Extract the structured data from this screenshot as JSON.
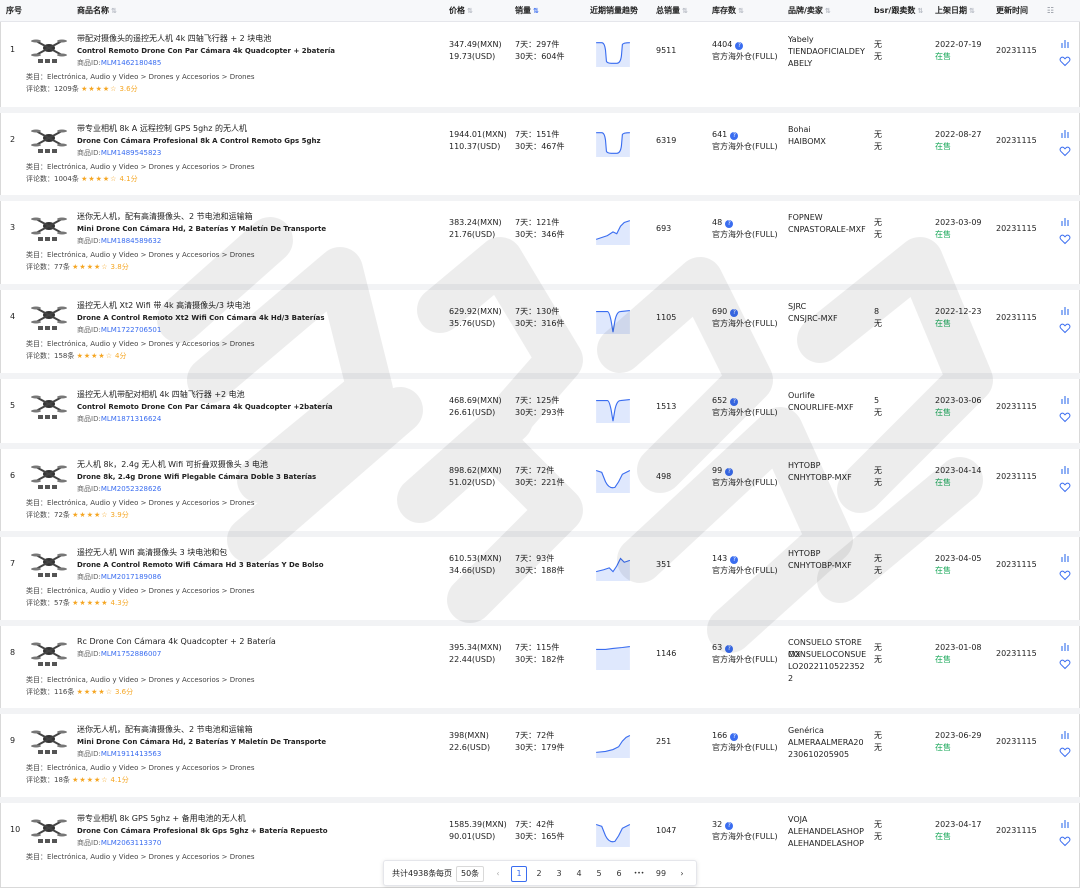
{
  "columns": {
    "idx": "序号",
    "name": "商品名称",
    "price": "价格",
    "sales": "销量",
    "trend": "近期销量趋势",
    "total": "总销量",
    "stock": "库存数",
    "brand": "品牌/卖家",
    "bsr": "bsr/跟卖数",
    "date": "上架日期",
    "updated": "更新时间"
  },
  "labels": {
    "cat_prefix": "类目：",
    "rev_prefix": "评论数：",
    "rev_unit": "条",
    "pid_prefix": "商品ID:",
    "score_unit": "分",
    "in_stock": "在售",
    "warehouse": "官方海外仓(FULL)",
    "d7": "7天：",
    "d30": "30天：",
    "unit": "件",
    "q": "?"
  },
  "colors": {
    "accent": "#3a6df0",
    "instock": "#1aa85a",
    "star": "#f5a623",
    "spark": "#3a6df0"
  },
  "rows": [
    {
      "idx": "1",
      "cn": "带配对摄像头的遥控无人机 4k 四轴飞行器 + 2 块电池",
      "es": "Control Remoto Drone Con Par Cámara 4k Quadcopter + 2batería",
      "pid": "MLM1462180485",
      "cat": "Electrónica, Audio y Video > Drones y Accesorios > Drones",
      "reviews": "1209",
      "stars": 3.5,
      "score": "3.6",
      "p_mxn": "347.49(MXN)",
      "p_usd": "19.73(USD)",
      "s7": "297",
      "s30": "604",
      "trend": "dip",
      "total": "9511",
      "stock": "4404",
      "brand1": "Yabely",
      "brand2": "TIENDAOFICIALDEYABELY",
      "bsr1": "无",
      "bsr2": "无",
      "date": "2022-07-19",
      "updated": "20231115"
    },
    {
      "idx": "2",
      "cn": "带专业相机 8k A 远程控制 GPS 5ghz 的无人机",
      "es": "Drone Con Cámara Profesional 8k A Control Remoto Gps 5ghz",
      "pid": "MLM1489545823",
      "cat": "Electrónica, Audio y Video > Drones y Accesorios > Drones",
      "reviews": "1004",
      "stars": 4,
      "score": "4.1",
      "p_mxn": "1944.01(MXN)",
      "p_usd": "110.37(USD)",
      "s7": "151",
      "s30": "467",
      "trend": "dip",
      "total": "6319",
      "stock": "641",
      "brand1": "Bohai",
      "brand2": "HAIBOMX",
      "bsr1": "无",
      "bsr2": "无",
      "date": "2022-08-27",
      "updated": "20231115"
    },
    {
      "idx": "3",
      "cn": "迷你无人机，配有高清摄像头、2 节电池和运输箱",
      "es": "Mini Drone Con Cámara Hd, 2 Baterías Y Maletín De Transporte",
      "pid": "MLM1884589632",
      "cat": "Electrónica, Audio y Video > Drones y Accesorios > Drones",
      "reviews": "77",
      "stars": 4,
      "score": "3.8",
      "p_mxn": "383.24(MXN)",
      "p_usd": "21.76(USD)",
      "s7": "121",
      "s30": "346",
      "trend": "rise",
      "total": "693",
      "stock": "48",
      "brand1": "FOPNEW",
      "brand2": "CNPASTORALE-MXF",
      "bsr1": "无",
      "bsr2": "无",
      "date": "2023-03-09",
      "updated": "20231115"
    },
    {
      "idx": "4",
      "cn": "遥控无人机 Xt2 Wifi 带 4k 高清摄像头/3 块电池",
      "es": "Drone A Control Remoto Xt2 Wifi Con Cámara 4k Hd/3 Baterías",
      "pid": "MLM1722706501",
      "cat": "Electrónica, Audio y Video > Drones y Accesorios > Drones",
      "reviews": "158",
      "stars": 4,
      "score": "4",
      "p_mxn": "629.92(MXN)",
      "p_usd": "35.76(USD)",
      "s7": "130",
      "s30": "316",
      "trend": "vdip",
      "total": "1105",
      "stock": "690",
      "brand1": "SJRC",
      "brand2": "CNSJRC-MXF",
      "bsr1": "8",
      "bsr2": "无",
      "date": "2022-12-23",
      "updated": "20231115"
    },
    {
      "idx": "5",
      "cn": "遥控无人机带配对相机 4k 四轴飞行器 +2 电池",
      "es": "Control Remoto Drone Con Par Cámara 4k Quadcopter +2batería",
      "pid": "MLM1871316624",
      "cat": "",
      "reviews": "",
      "stars": 0,
      "score": "",
      "p_mxn": "468.69(MXN)",
      "p_usd": "26.61(USD)",
      "s7": "125",
      "s30": "293",
      "trend": "vdip",
      "total": "1513",
      "stock": "652",
      "brand1": "Ourlife",
      "brand2": "CNOURLIFE-MXF",
      "bsr1": "5",
      "bsr2": "无",
      "date": "2023-03-06",
      "updated": "20231115"
    },
    {
      "idx": "6",
      "cn": "无人机 8k，2.4g 无人机 Wifi 可折叠双摄像头 3 电池",
      "es": "Drone 8k, 2.4g Drone Wifi Plegable Cámara Doble 3 Baterías",
      "pid": "MLM2052328626",
      "cat": "Electrónica, Audio y Video > Drones y Accesorios > Drones",
      "reviews": "72",
      "stars": 4,
      "score": "3.9",
      "p_mxn": "898.62(MXN)",
      "p_usd": "51.02(USD)",
      "s7": "72",
      "s30": "221",
      "trend": "udip",
      "total": "498",
      "stock": "99",
      "brand1": "HYTOBP",
      "brand2": "CNHYTOBP-MXF",
      "bsr1": "无",
      "bsr2": "无",
      "date": "2023-04-14",
      "updated": "20231115"
    },
    {
      "idx": "7",
      "cn": "遥控无人机 Wifi 高清摄像头 3 块电池和包",
      "es": "Drone A Control Remoto Wifi Cámara Hd 3 Baterías Y De Bolso",
      "pid": "MLM2017189086",
      "cat": "Electrónica, Audio y Video > Drones y Accesorios > Drones",
      "reviews": "57",
      "stars": 4.5,
      "score": "4.3",
      "p_mxn": "610.53(MXN)",
      "p_usd": "34.66(USD)",
      "s7": "93",
      "s30": "188",
      "trend": "wave",
      "total": "351",
      "stock": "143",
      "brand1": "HYTOBP",
      "brand2": "CNHYTOBP-MXF",
      "bsr1": "无",
      "bsr2": "无",
      "date": "2023-04-05",
      "updated": "20231115"
    },
    {
      "idx": "8",
      "cn": "Rc Drone Con Cámara 4k Quadcopter + 2 Batería",
      "es": "",
      "pid": "MLM1752886007",
      "cat": "Electrónica, Audio y Video > Drones y Accesorios > Drones",
      "reviews": "116",
      "stars": 3.5,
      "score": "3.6",
      "p_mxn": "395.34(MXN)",
      "p_usd": "22.44(USD)",
      "s7": "115",
      "s30": "182",
      "trend": "flat",
      "total": "1146",
      "stock": "63",
      "brand1": "CONSUELO STORE MX",
      "brand2": "CONSUELOCONSUELO20221105223522",
      "bsr1": "无",
      "bsr2": "无",
      "date": "2023-01-08",
      "updated": "20231115"
    },
    {
      "idx": "9",
      "cn": "迷你无人机，配有高清摄像头、2 节电池和运输箱",
      "es": "Mini Drone Con Cámara Hd, 2 Baterías Y Maletín De Transporte",
      "pid": "MLM1911413563",
      "cat": "Electrónica, Audio y Video > Drones y Accesorios > Drones",
      "reviews": "18",
      "stars": 4,
      "score": "4.1",
      "p_mxn": "398(MXN)",
      "p_usd": "22.6(USD)",
      "s7": "72",
      "s30": "179",
      "trend": "rise2",
      "total": "251",
      "stock": "166",
      "brand1": "Genérica",
      "brand2": "ALMERAALMERA20230610205905",
      "bsr1": "无",
      "bsr2": "无",
      "date": "2023-06-29",
      "updated": "20231115"
    },
    {
      "idx": "10",
      "cn": "带专业相机 8k GPS 5ghz + 备用电池的无人机",
      "es": "Drone Con Cámara Profesional 8k Gps 5ghz + Batería Repuesto",
      "pid": "MLM2063113370",
      "cat": "Electrónica, Audio y Video > Drones y Accesorios > Drones",
      "reviews": "",
      "stars": 0,
      "score": "",
      "p_mxn": "1585.39(MXN)",
      "p_usd": "90.01(USD)",
      "s7": "42",
      "s30": "165",
      "trend": "udip",
      "total": "1047",
      "stock": "32",
      "brand1": "VOJA",
      "brand2": "ALEHANDELASHOPALEHANDELASHOP",
      "bsr1": "无",
      "bsr2": "无",
      "date": "2023-04-17",
      "updated": "20231115"
    }
  ],
  "pager": {
    "total_text": "共计4938条",
    "per_page_label": "每页",
    "per_page": "50条",
    "prev": "‹",
    "next": "›",
    "pages": [
      "1",
      "2",
      "3",
      "4",
      "5",
      "6"
    ],
    "ellipsis": "•••",
    "last": "99",
    "current": "1"
  }
}
